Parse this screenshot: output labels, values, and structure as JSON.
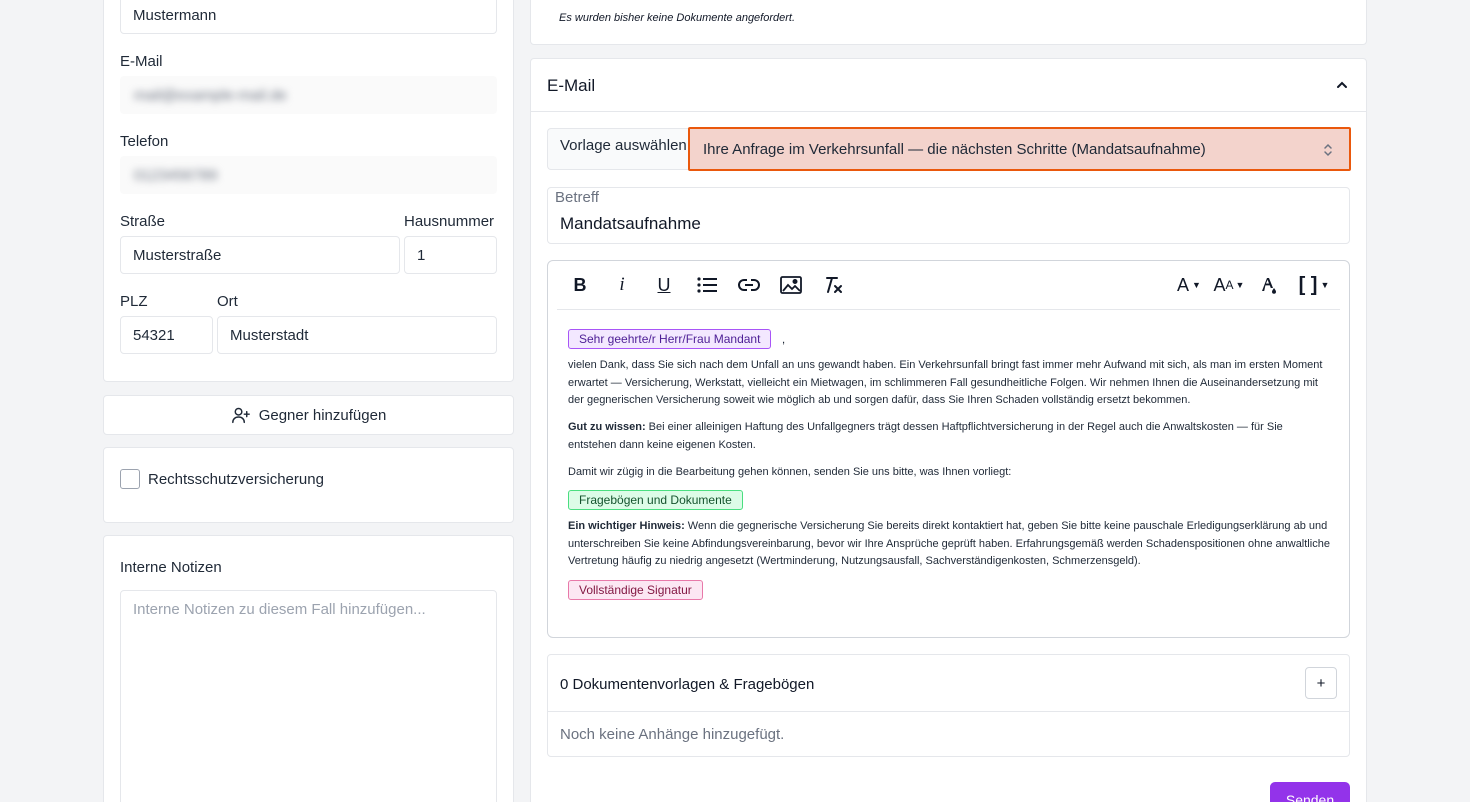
{
  "left": {
    "lastname_value": "Mustermann",
    "email_label": "E-Mail",
    "email_value": "mail@example-mail.de",
    "phone_label": "Telefon",
    "phone_value": "0123456789",
    "street_label": "Straße",
    "street_value": "Musterstraße",
    "housenumber_label": "Hausnummer",
    "housenumber_value": "1",
    "zip_label": "PLZ",
    "zip_value": "54321",
    "city_label": "Ort",
    "city_value": "Musterstadt",
    "add_opponent_label": "Gegner hinzufügen",
    "legal_insurance_label": "Rechtsschutzversicherung",
    "internal_notes_label": "Interne Notizen",
    "internal_notes_placeholder": "Interne Notizen zu diesem Fall hinzufügen..."
  },
  "documents": {
    "empty_text": "Es wurden bisher keine Dokumente angefordert."
  },
  "email": {
    "section_title": "E-Mail",
    "template_label": "Vorlage auswählen",
    "template_selected": "Ihre Anfrage im Verkehrsunfall — die nächsten Schritte (Mandatsaufnahme)",
    "subject_label": "Betreff",
    "subject_value": "Mandatsaufnahme",
    "greeting_chip": "Sehr geehrte/r Herr/Frau Mandant",
    "greeting_comma": ",",
    "para1": "vielen Dank, dass Sie sich nach dem Unfall an uns gewandt haben. Ein Verkehrsunfall bringt fast immer mehr Aufwand mit sich, als man im ersten Moment erwartet — Versicherung, Werkstatt, vielleicht ein Mietwagen, im schlimmeren Fall gesundheitliche Folgen. Wir nehmen Ihnen die Auseinandersetzung mit der gegnerischen Versicherung soweit wie möglich ab und sorgen dafür, dass Sie Ihren Schaden vollständig ersetzt bekommen.",
    "para2_bold": "Gut zu wissen:",
    "para2": " Bei einer alleinigen Haftung des Unfallgegners trägt dessen Haftpflichtversicherung in der Regel auch die Anwaltskosten — für Sie entstehen dann keine eigenen Kosten.",
    "para3": "Damit wir zügig in die Bearbeitung gehen können, senden Sie uns bitte, was Ihnen vorliegt:",
    "forms_chip": "Fragebögen und Dokumente",
    "para4_bold": "Ein wichtiger Hinweis:",
    "para4": " Wenn die gegnerische Versicherung Sie bereits direkt kontaktiert hat, geben Sie bitte keine pauschale Erledigungserklärung ab und unterschreiben Sie keine Abfindungsvereinbarung, bevor wir Ihre Ansprüche geprüft haben. Erfahrungsgemäß werden Schadenspositionen ohne anwaltliche Vertretung häufig zu niedrig angesetzt (Wertminderung, Nutzungsausfall, Sachverständigenkosten, Schmerzensgeld).",
    "signature_chip": "Vollständige Signatur",
    "attachments_title": "0 Dokumentenvorlagen & Fragebögen",
    "attachments_add": "+",
    "attachments_empty": "Noch keine Anhänge hinzugefügt.",
    "send_label": "Senden"
  },
  "colors": {
    "accent": "#9333ea",
    "select_highlight_bg": "#f3d3cc",
    "select_highlight_border": "#ea580c"
  }
}
